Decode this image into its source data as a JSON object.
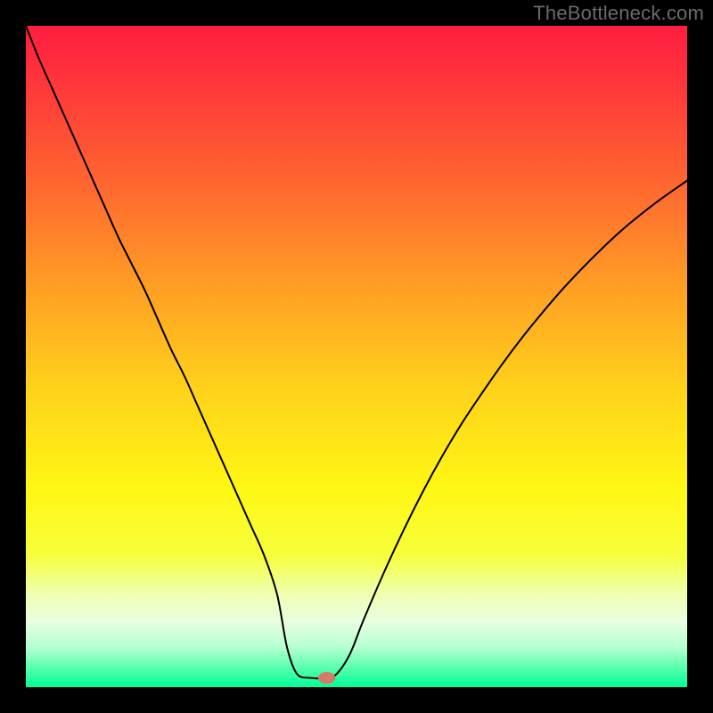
{
  "watermark": "TheBottleneck.com",
  "chart_data": {
    "type": "line",
    "title": "",
    "xlabel": "",
    "ylabel": "",
    "xlim": [
      0,
      100
    ],
    "ylim": [
      0,
      100
    ],
    "grid": false,
    "legend": false,
    "background": {
      "type": "vertical-gradient",
      "stops": [
        {
          "offset": 0.0,
          "color": "#ff1d3f"
        },
        {
          "offset": 0.1,
          "color": "#ff3a3a"
        },
        {
          "offset": 0.25,
          "color": "#ff6a2f"
        },
        {
          "offset": 0.4,
          "color": "#ffa024"
        },
        {
          "offset": 0.55,
          "color": "#ffd21a"
        },
        {
          "offset": 0.7,
          "color": "#fff714"
        },
        {
          "offset": 0.8,
          "color": "#f7ff3a"
        },
        {
          "offset": 0.86,
          "color": "#efffb2"
        },
        {
          "offset": 0.9,
          "color": "#e9ffe0"
        },
        {
          "offset": 0.94,
          "color": "#b5ffd0"
        },
        {
          "offset": 0.97,
          "color": "#5affad"
        },
        {
          "offset": 1.0,
          "color": "#00ff99"
        }
      ]
    },
    "series": [
      {
        "name": "bottleneck-curve",
        "color": "#000000",
        "width": 2,
        "x": [
          0,
          2,
          4,
          6,
          8,
          10,
          12,
          14,
          16,
          18,
          20,
          22,
          24,
          26,
          28,
          30,
          32,
          34,
          36,
          38,
          39.5,
          41,
          43,
          45.5,
          47,
          49,
          51,
          54,
          57,
          60,
          63,
          66,
          69,
          72,
          75,
          78,
          81,
          84,
          87,
          90,
          93,
          96,
          100
        ],
        "y": [
          100,
          95,
          90.5,
          86,
          81.5,
          77,
          72.5,
          68,
          64,
          60,
          55.5,
          51,
          47,
          42.5,
          38,
          33.5,
          29,
          24.5,
          20,
          14,
          6,
          2.0,
          1.4,
          1.4,
          2.0,
          5.0,
          10.0,
          17.0,
          23.5,
          29.5,
          35.0,
          40.0,
          44.5,
          48.8,
          52.8,
          56.5,
          60.0,
          63.2,
          66.2,
          69.0,
          71.5,
          73.8,
          76.6
        ]
      }
    ],
    "marker": {
      "name": "optimal-point",
      "x": 45.5,
      "y": 1.4,
      "rx": 1.3,
      "ry": 0.9,
      "fill": "#d87a6a"
    }
  }
}
